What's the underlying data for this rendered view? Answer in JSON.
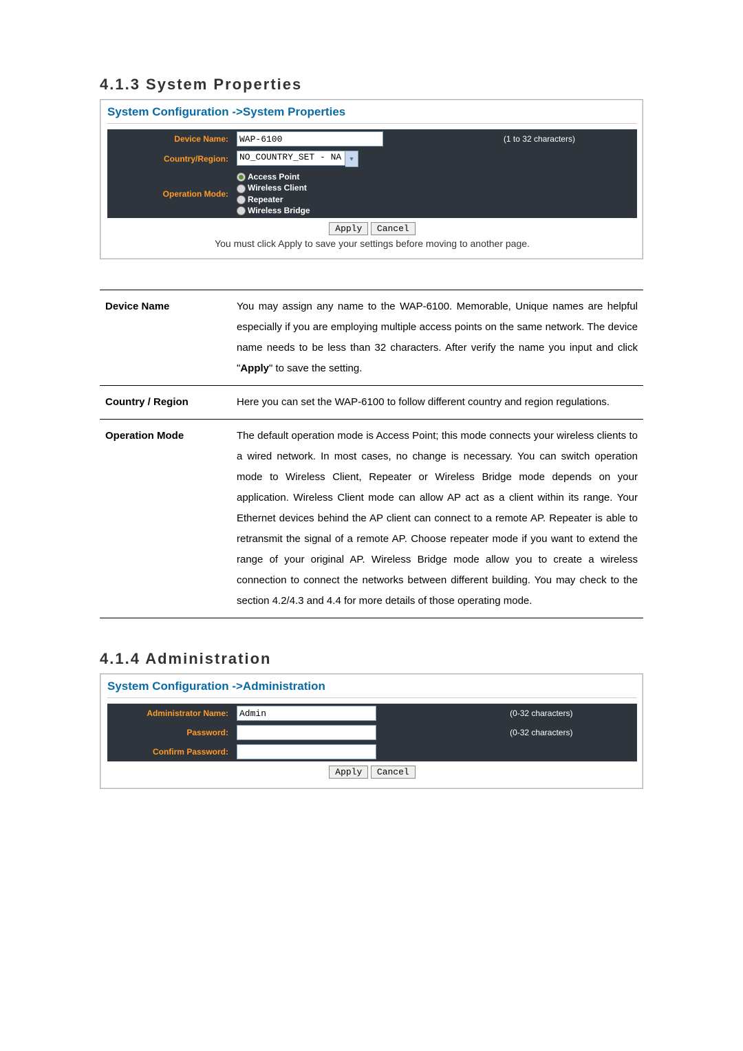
{
  "section1": {
    "heading": "4.1.3 System Properties",
    "shot": {
      "title": "System Configuration ->System Properties",
      "device_name_label": "Device Name:",
      "device_name_value": "WAP-6100",
      "device_name_hint": "(1 to 32 characters)",
      "country_label": "Country/Region:",
      "country_value": "NO_COUNTRY_SET - NA",
      "opmode_label": "Operation Mode:",
      "opmodes": [
        {
          "label": "Access Point",
          "selected": true
        },
        {
          "label": "Wireless Client",
          "selected": false
        },
        {
          "label": "Repeater",
          "selected": false
        },
        {
          "label": "Wireless Bridge",
          "selected": false
        }
      ],
      "apply": "Apply",
      "cancel": "Cancel",
      "note": "You must click Apply to save your settings before moving to another page."
    },
    "desc": {
      "row1_key": "Device Name",
      "row1_val_a": "You may assign any name to the WAP-6100. Memorable, Unique names are helpful especially if you are employing multiple access points on the same network. The device name needs to be less than 32 characters. After verify the name you input and click \"",
      "row1_val_bold": "Apply",
      "row1_val_b": "\" to save the setting.",
      "row2_key": "Country / Region",
      "row2_val": "Here you can set the WAP-6100 to follow different country and region regulations.",
      "row3_key": "Operation Mode",
      "row3_val": "The default operation mode is Access Point; this mode connects your wireless clients to a wired network. In most cases, no change is necessary. You can switch operation mode to Wireless Client, Repeater or Wireless Bridge mode depends on your application. Wireless Client mode can allow AP act as a client within its range. Your Ethernet devices behind the AP client can connect to a remote AP. Repeater is able to retransmit the signal of a remote AP. Choose repeater mode if you want to extend the range of your original AP. Wireless Bridge mode allow you to create a wireless connection to connect the networks between different building. You may check to the section 4.2/4.3 and 4.4 for more details of those operating mode."
    }
  },
  "section2": {
    "heading": "4.1.4 Administration",
    "shot": {
      "title": "System Configuration ->Administration",
      "admin_name_label": "Administrator Name:",
      "admin_name_value": "Admin",
      "admin_name_hint": "(0-32 characters)",
      "password_label": "Password:",
      "password_hint": "(0-32 characters)",
      "confirm_label": "Confirm Password:",
      "apply": "Apply",
      "cancel": "Cancel"
    }
  }
}
